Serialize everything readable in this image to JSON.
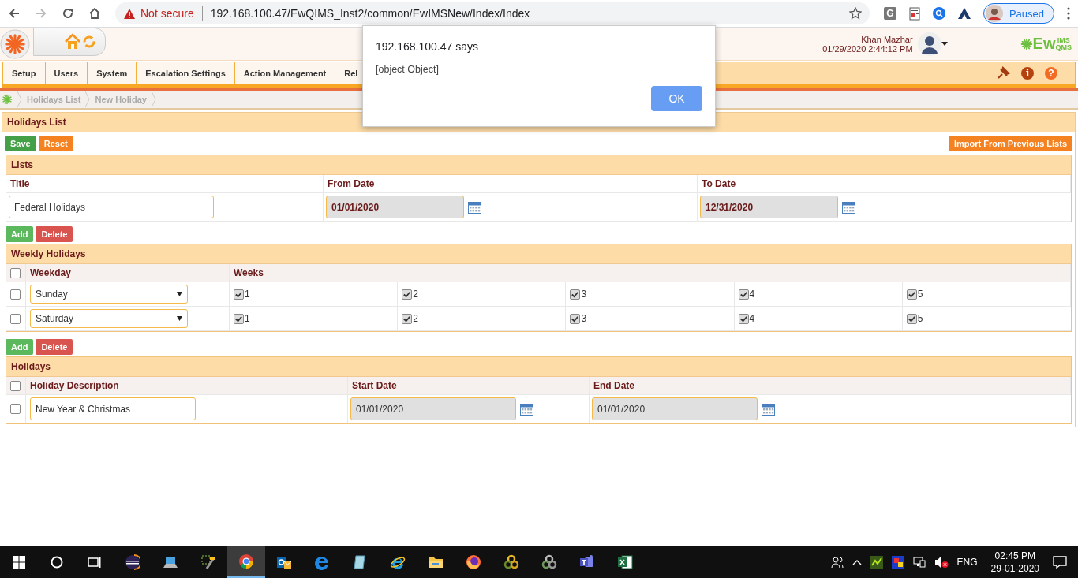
{
  "browser": {
    "security_label": "Not secure",
    "url": "192.168.100.47/EwQIMS_Inst2/common/EwIMSNew/Index/Index",
    "extension_label": "G",
    "profile_label": "Paused"
  },
  "header": {
    "user_name": "Khan Mazhar",
    "datetime": "01/29/2020 2:44:12 PM",
    "brand": {
      "main": "Ew",
      "upper": "IMS",
      "lower": "QMS"
    }
  },
  "menu": {
    "tabs": [
      "Setup",
      "Users",
      "System",
      "Escalation Settings",
      "Action Management",
      "Rel"
    ],
    "info_glyph": "i",
    "help_glyph": "?"
  },
  "breadcrumb": [
    "Holidays List",
    "New Holiday"
  ],
  "panel": {
    "title": "Holidays List",
    "buttons": [
      {
        "label": "Save",
        "kind": "save"
      },
      {
        "label": "Reset",
        "kind": "reset"
      }
    ],
    "import_button": "Import From Previous Lists"
  },
  "lists": {
    "title": "Lists",
    "columns": [
      "Title",
      "From Date",
      "To Date"
    ],
    "row": {
      "title": "Federal Holidays",
      "from_date": "01/01/2020",
      "to_date": "12/31/2020"
    }
  },
  "weekly": {
    "buttons": [
      {
        "label": "Add",
        "kind": "add"
      },
      {
        "label": "Delete",
        "kind": "delete"
      }
    ],
    "title": "Weekly Holidays",
    "all_checked": false,
    "columns": [
      "Weekday",
      "Weeks"
    ],
    "rows": [
      {
        "checked": false,
        "weekday": "Sunday",
        "weeks": [
          {
            "label": "1",
            "checked": true
          },
          {
            "label": "2",
            "checked": true
          },
          {
            "label": "3",
            "checked": true
          },
          {
            "label": "4",
            "checked": true
          },
          {
            "label": "5",
            "checked": true
          }
        ]
      },
      {
        "checked": false,
        "weekday": "Saturday",
        "weeks": [
          {
            "label": "1",
            "checked": true
          },
          {
            "label": "2",
            "checked": true
          },
          {
            "label": "3",
            "checked": true
          },
          {
            "label": "4",
            "checked": true
          },
          {
            "label": "5",
            "checked": true
          }
        ]
      }
    ]
  },
  "holidays": {
    "buttons": [
      {
        "label": "Add",
        "kind": "add"
      },
      {
        "label": "Delete",
        "kind": "delete"
      }
    ],
    "title": "Holidays",
    "all_checked": false,
    "columns": [
      "Holiday Description",
      "Start Date",
      "End Date"
    ],
    "rows": [
      {
        "checked": false,
        "description": "New Year & Christmas",
        "start_date": "01/01/2020",
        "end_date": "01/01/2020"
      }
    ]
  },
  "dialog": {
    "title": "192.168.100.47 says",
    "message": "[object Object]",
    "button": "OK"
  },
  "taskbar": {
    "apps": [
      {
        "kind": "sphere",
        "selected": false
      },
      {
        "kind": "laptop",
        "selected": false
      },
      {
        "kind": "tools",
        "selected": false
      },
      {
        "kind": "chrome",
        "selected": true
      },
      {
        "kind": "mail",
        "selected": false
      },
      {
        "kind": "edge",
        "selected": false
      },
      {
        "kind": "notepad",
        "selected": false
      },
      {
        "kind": "ie",
        "selected": false
      },
      {
        "kind": "folder",
        "selected": false
      },
      {
        "kind": "firefox",
        "selected": false
      },
      {
        "kind": "rings-gold",
        "selected": false
      },
      {
        "kind": "rings-grey",
        "selected": false
      },
      {
        "kind": "teams",
        "selected": false
      },
      {
        "kind": "excel",
        "selected": false
      }
    ],
    "language": "ENG",
    "time": "02:45 PM",
    "date": "29-01-2020"
  }
}
